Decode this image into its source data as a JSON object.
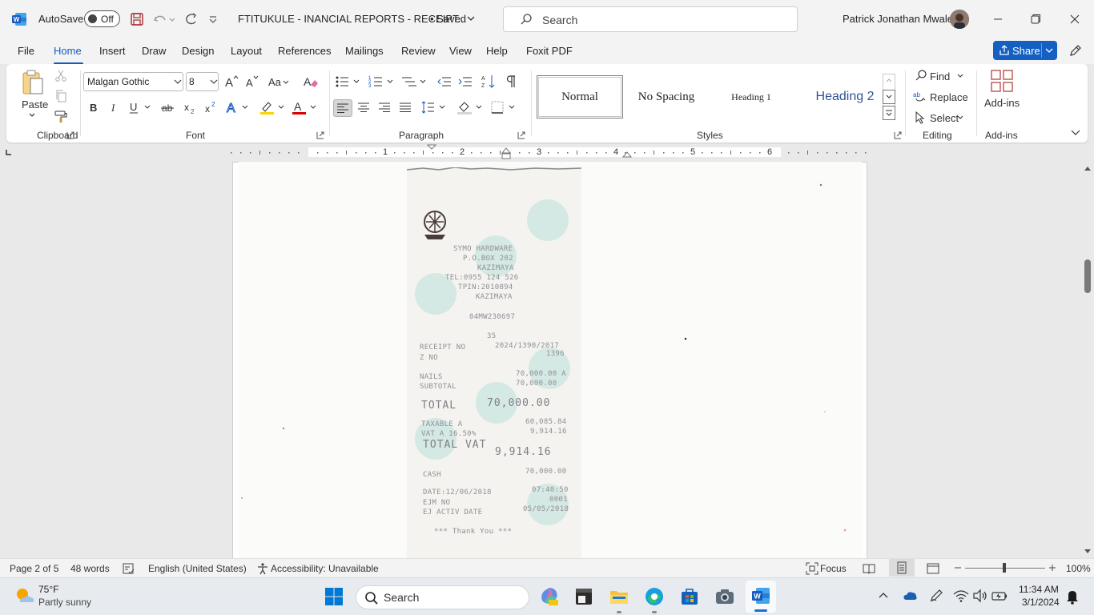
{
  "titlebar": {
    "autosave_label": "AutoSave",
    "autosave_state": "Off",
    "doc_title": "FTITUKULE - INANCIAL REPORTS - RECEIPT...",
    "doc_saved": "• Saved",
    "search_placeholder": "Search",
    "user_name": "Patrick Jonathan Mwale"
  },
  "tabs": [
    "File",
    "Home",
    "Insert",
    "Draw",
    "Design",
    "Layout",
    "References",
    "Mailings",
    "Review",
    "View",
    "Help",
    "Foxit PDF"
  ],
  "share_label": "Share",
  "ribbon": {
    "paste_label": "Paste",
    "font_name": "Malgan Gothic",
    "font_size": "8",
    "groups": {
      "clipboard": "Clipboard",
      "font": "Font",
      "paragraph": "Paragraph",
      "styles": "Styles",
      "editing": "Editing",
      "addins": "Add-ins"
    },
    "styles": [
      "Normal",
      "No Spacing",
      "Heading 1",
      "Heading 2"
    ],
    "find_label": "Find",
    "replace_label": "Replace",
    "select_label": "Select",
    "addins_label": "Add-ins"
  },
  "ruler_numbers": [
    "1",
    "2",
    "3",
    "4",
    "5",
    "6"
  ],
  "receipt_lines": {
    "l1": "SYMO HARDWARE",
    "l2": "P.O.BOX 202",
    "l3": "KAZIMAYA",
    "l4": "TEL:0955 124 526 ",
    "l5": "TPIN:2010894",
    "l6": "KAZIMAYA",
    "l7": "04MW230697",
    "l8": "35",
    "l9a": "RECEIPT NO",
    "l9b": "2024/1390/2017",
    "l10a": "Z NO",
    "l10b": "1396",
    "l11a": "NAILS",
    "l11b": "70,000.00 A",
    "l12a": "SUBTOTAL",
    "l12b": "70,000.00",
    "l13a": "TOTAL",
    "l13b": "70,000.00",
    "l14a": "TAXABLE A",
    "l14b": "60,085.84",
    "l15a": "VAT A 16.50%",
    "l15b": "9,914.16",
    "l16a": "TOTAL VAT",
    "l16b": "9,914.16",
    "l17a": "CASH",
    "l17b": "70,000.00",
    "l18a": "DATE:12/06/2018",
    "l18b": "07:40:50",
    "l19a": "EJM NO",
    "l19b": "0001",
    "l20a": "EJ ACTIV DATE",
    "l20b": "05/05/2018",
    "l21": "*** Thank You ***"
  },
  "statusbar": {
    "page": "Page 2 of 5",
    "words": "48 words",
    "language": "English (United States)",
    "accessibility": "Accessibility: Unavailable",
    "focus": "Focus",
    "zoom": "100%"
  },
  "taskbar": {
    "weather_temp": "75°F",
    "weather_desc": "Partly sunny",
    "search_placeholder": "Search",
    "time": "11:34 AM",
    "date": "3/1/2024"
  },
  "colors": {
    "accent": "#185abd",
    "share": "#1460c2",
    "word": "#185abd"
  }
}
